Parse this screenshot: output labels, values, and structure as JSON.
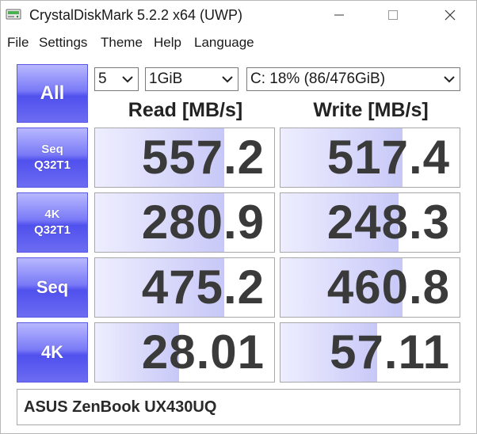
{
  "window": {
    "title": "CrystalDiskMark 5.2.2 x64 (UWP)",
    "icon": "disk-drive-icon",
    "controls": {
      "minimize": "minimize-icon",
      "maximize": "maximize-icon",
      "close": "close-icon"
    }
  },
  "menu": [
    "File",
    "Settings",
    "Theme",
    "Help",
    "Language"
  ],
  "controls": {
    "all_label": "All",
    "count": "5",
    "size": "1GiB",
    "drive": "C: 18% (86/476GiB)"
  },
  "headers": {
    "read": "Read [MB/s]",
    "write": "Write [MB/s]"
  },
  "tests": [
    {
      "label": "Seq\nQ32T1",
      "read": "557.2",
      "write": "517.4",
      "read_fill": 0.72,
      "write_fill": 0.68
    },
    {
      "label": "4K\nQ32T1",
      "read": "280.9",
      "write": "248.3",
      "read_fill": 0.72,
      "write_fill": 0.66
    },
    {
      "label": "Seq",
      "read": "475.2",
      "write": "460.8",
      "read_fill": 0.72,
      "write_fill": 0.68
    },
    {
      "label": "4K",
      "read": "28.01",
      "write": "57.11",
      "read_fill": 0.47,
      "write_fill": 0.54
    }
  ],
  "comment": "ASUS ZenBook UX430UQ",
  "colors": {
    "button_blue": "#6c6cf2",
    "bar_fill": "#c8c8f8",
    "value_text": "#3a3a3a"
  }
}
